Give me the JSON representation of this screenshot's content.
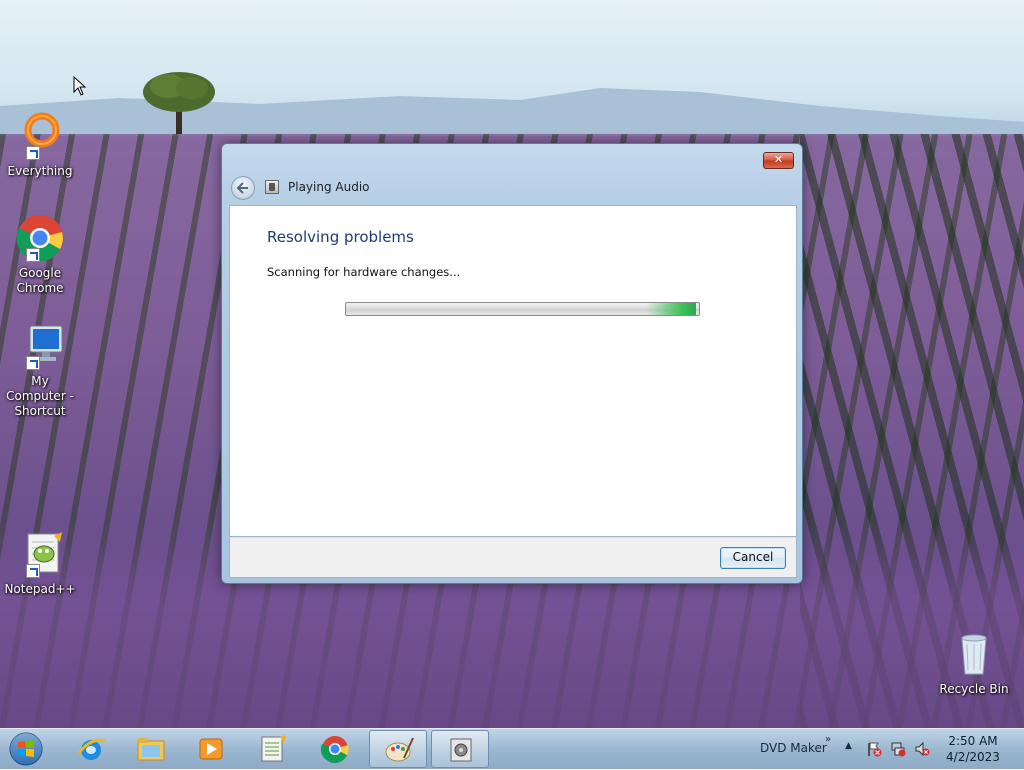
{
  "desktop": {
    "icons": [
      {
        "label": "Everything"
      },
      {
        "label": "Google Chrome"
      },
      {
        "label": "My Computer - Shortcut"
      },
      {
        "label": "Notepad++"
      },
      {
        "label": "Recycle Bin"
      }
    ]
  },
  "dialog": {
    "title": "Playing Audio",
    "close_label": "✕",
    "heading": "Resolving problems",
    "status": "Scanning for hardware changes...",
    "progress_fraction": 0.85,
    "cancel_label": "Cancel"
  },
  "taskbar": {
    "items": [
      {
        "icon": "internet-explorer-icon"
      },
      {
        "icon": "file-explorer-icon"
      },
      {
        "icon": "media-player-icon"
      },
      {
        "icon": "notepad-plus-plus-icon"
      },
      {
        "icon": "chrome-icon"
      },
      {
        "icon": "paint-icon"
      },
      {
        "icon": "troubleshooter-icon"
      }
    ],
    "toolbar_label": "DVD Maker",
    "toolbar_chevron": "»",
    "tray_up": "▲",
    "time": "2:50 AM",
    "date": "4/2/2023"
  },
  "colors": {
    "heading": "#1d3d70",
    "progress": "#3fc35b",
    "close": "#c1391f"
  }
}
